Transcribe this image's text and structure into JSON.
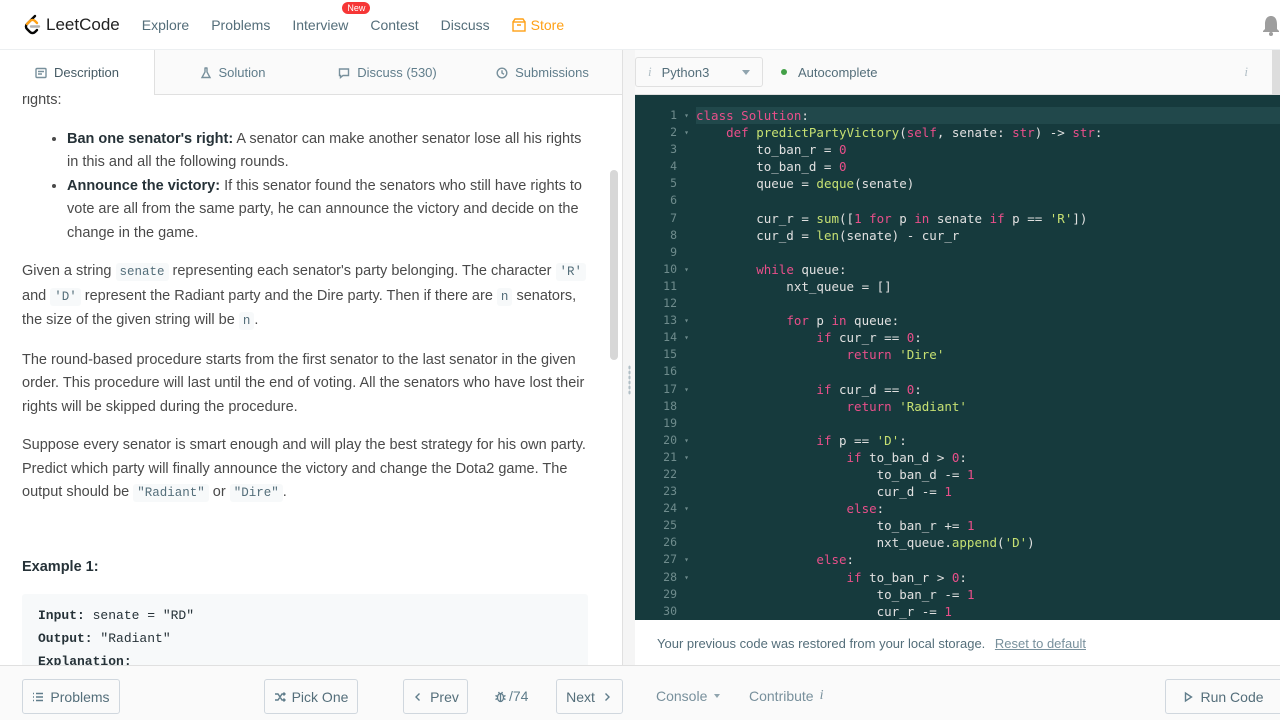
{
  "topnav": {
    "brand": "LeetCode",
    "links": [
      "Explore",
      "Problems",
      "Interview",
      "Contest",
      "Discuss"
    ],
    "interview_badge": "New",
    "store": "Store",
    "accent_color": "#ffa116"
  },
  "left_tabs": {
    "description": "Description",
    "solution": "Solution",
    "discuss": "Discuss (530)",
    "submissions": "Submissions"
  },
  "description": {
    "top_fragment": "rights:",
    "bullets": [
      {
        "title": "Ban one senator's right:",
        "text": " A senator can make another senator lose all his rights in this and all the following rounds."
      },
      {
        "title": "Announce the victory:",
        "text": " If this senator found the senators who still have rights to vote are all from the same party, he can announce the victory and decide on the change in the game."
      }
    ],
    "p1": {
      "a": "Given a string ",
      "code1": "senate",
      "b": " representing each senator's party belonging. The character ",
      "code2": "'R'",
      "c": " and ",
      "code3": "'D'",
      "d": " represent the Radiant party and the Dire party. Then if there are ",
      "code4": "n",
      "e": " senators, the size of the given string will be ",
      "code5": "n",
      "f": "."
    },
    "p2": "The round-based procedure starts from the first senator to the last senator in the given order. This procedure will last until the end of voting. All the senators who have lost their rights will be skipped during the procedure.",
    "p3": {
      "a": "Suppose every senator is smart enough and will play the best strategy for his own party. Predict which party will finally announce the victory and change the Dota2 game. The output should be ",
      "code1": "\"Radiant\"",
      "b": " or ",
      "code2": "\"Dire\"",
      "c": "."
    },
    "example_title": "Example 1:",
    "example": {
      "input_label": "Input:",
      "input_value": " senate = \"RD\"",
      "output_label": "Output:",
      "output_value": " \"Radiant\"",
      "explanation_label": "Explanation:"
    }
  },
  "editor_toolbar": {
    "language": "Python3",
    "autocomplete": "Autocomplete",
    "info_glyph": "i"
  },
  "code_lines": [
    "class Solution:",
    "    def predictPartyVictory(self, senate: str) -> str:",
    "        to_ban_r = 0",
    "        to_ban_d = 0",
    "        queue = deque(senate)",
    "",
    "        cur_r = sum([1 for p in senate if p == 'R'])",
    "        cur_d = len(senate) - cur_r",
    "",
    "        while queue:",
    "            nxt_queue = []",
    "",
    "            for p in queue:",
    "                if cur_r == 0:",
    "                    return 'Dire'",
    "",
    "                if cur_d == 0:",
    "                    return 'Radiant'",
    "",
    "                if p == 'D':",
    "                    if to_ban_d > 0:",
    "                        to_ban_d -= 1",
    "                        cur_d -= 1",
    "                    else:",
    "                        to_ban_r += 1",
    "                        nxt_queue.append('D')",
    "                else:",
    "                    if to_ban_r > 0:",
    "                        to_ban_r -= 1",
    "                        cur_r -= 1"
  ],
  "fold_lines": [
    1,
    2,
    10,
    13,
    14,
    17,
    20,
    21,
    24,
    27,
    28
  ],
  "notice": {
    "text": "Your previous code was restored from your local storage.",
    "reset_link": "Reset to default"
  },
  "bottombar": {
    "problems": "Problems",
    "pick_one": "Pick One",
    "prev": "Prev",
    "pager": "/74",
    "next": "Next",
    "console": "Console",
    "contribute": "Contribute",
    "contribute_info": "i",
    "run_code": "Run Code"
  }
}
